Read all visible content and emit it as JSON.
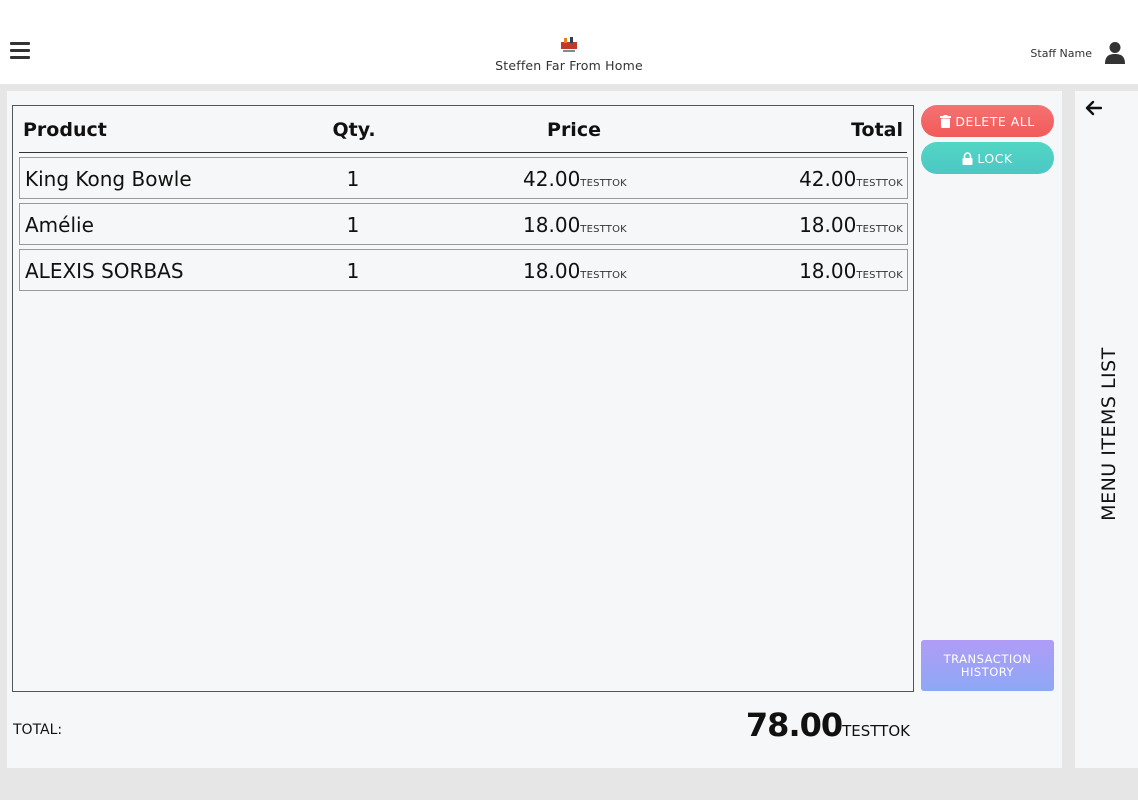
{
  "header": {
    "menu_icon": "hamburger-icon",
    "brand_name": "Steffen Far From Home",
    "staff_name": "Staff Name",
    "avatar_icon": "user-icon"
  },
  "cart": {
    "columns": {
      "product": "Product",
      "qty": "Qty.",
      "price": "Price",
      "total": "Total"
    },
    "currency": "TESTTOK",
    "items": [
      {
        "product": "King Kong Bowle",
        "qty": "1",
        "price": "42.00",
        "total": "42.00"
      },
      {
        "product": "Amélie",
        "qty": "1",
        "price": "18.00",
        "total": "18.00"
      },
      {
        "product": "ALEXIS SORBAS",
        "qty": "1",
        "price": "18.00",
        "total": "18.00"
      }
    ],
    "total_label": "TOTAL:",
    "total_value": "78.00"
  },
  "actions": {
    "delete_all": "DELETE ALL",
    "lock": "LOCK",
    "history_line1": "TRANSACTION",
    "history_line2": "HISTORY"
  },
  "side_panel": {
    "title": "MENU ITEMS LIST",
    "back_icon": "arrow-left-icon"
  },
  "colors": {
    "delete": "#f25f5f",
    "lock": "#4dcfc5",
    "history": "#9fa3f5",
    "panel_bg": "#f6f7f9",
    "page_bg": "#e6e6e6"
  }
}
